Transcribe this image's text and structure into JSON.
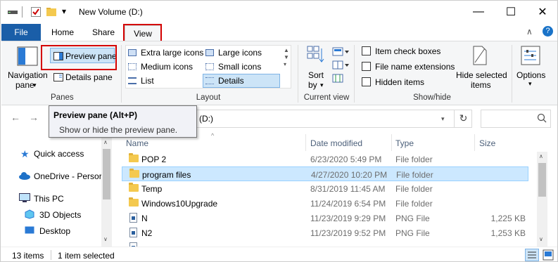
{
  "window": {
    "title": "New Volume (D:)",
    "controls": {
      "minimize": "—",
      "maximize": "☐",
      "close": "✕"
    },
    "qat_dropdown": "▾"
  },
  "tabs": {
    "file": "File",
    "home": "Home",
    "share": "Share",
    "view": "View"
  },
  "ribbon": {
    "panes": {
      "navigation_pane": "Navigation",
      "navigation_pane_2": "pane",
      "preview_pane": "Preview pane",
      "details_pane": "Details pane",
      "group_label": "Panes"
    },
    "layout": {
      "items": [
        "Extra large icons",
        "Large icons",
        "Medium icons",
        "Small icons",
        "List",
        "Details"
      ],
      "group_label": "Layout",
      "selected": "Details"
    },
    "current_view": {
      "sort_by": "Sort",
      "sort_by_2": "by",
      "group_label": "Current view"
    },
    "show_hide": {
      "item_check_boxes": "Item check boxes",
      "file_name_extensions": "File name extensions",
      "hidden_items": "Hidden items",
      "hide_selected_items": "Hide selected",
      "hide_selected_items_2": "items",
      "group_label": "Show/hide"
    },
    "options": {
      "label": "Options"
    }
  },
  "tooltip": {
    "title": "Preview pane (Alt+P)",
    "body": "Show or hide the preview pane."
  },
  "address_bar": {
    "path": "(D:)",
    "refresh": "↻",
    "back": "←",
    "forward": "→"
  },
  "nav_pane": {
    "items": [
      {
        "label": "Quick access",
        "icon": "star-icon"
      },
      {
        "label": "OneDrive - Persor",
        "icon": "cloud-icon"
      },
      {
        "label": "This PC",
        "icon": "computer-icon"
      },
      {
        "label": "3D Objects",
        "icon": "cube-icon"
      },
      {
        "label": "Desktop",
        "icon": "desktop-icon"
      }
    ]
  },
  "file_list": {
    "columns": {
      "name": "Name",
      "date_modified": "Date modified",
      "type": "Type",
      "size": "Size"
    },
    "rows": [
      {
        "name": "POP 2",
        "date": "6/23/2020 5:49 PM",
        "type": "File folder",
        "size": "",
        "icon": "folder-icon",
        "selected": false
      },
      {
        "name": "program files",
        "date": "4/27/2020 10:20 PM",
        "type": "File folder",
        "size": "",
        "icon": "folder-icon",
        "selected": true
      },
      {
        "name": "Temp",
        "date": "8/31/2019 11:45 AM",
        "type": "File folder",
        "size": "",
        "icon": "folder-icon",
        "selected": false
      },
      {
        "name": "Windows10Upgrade",
        "date": "11/24/2019 6:54 PM",
        "type": "File folder",
        "size": "",
        "icon": "folder-icon",
        "selected": false
      },
      {
        "name": "N",
        "date": "11/23/2019 9:29 PM",
        "type": "PNG File",
        "size": "1,225 KB",
        "icon": "png-file-icon",
        "selected": false
      },
      {
        "name": "N2",
        "date": "11/23/2019 9:52 PM",
        "type": "PNG File",
        "size": "1,253 KB",
        "icon": "png-file-icon",
        "selected": false
      }
    ]
  },
  "status_bar": {
    "item_count": "13 items",
    "selected_count": "1 item selected"
  },
  "colors": {
    "file_tab": "#1a5ea8",
    "selection": "#cce8ff",
    "highlight_box": "#d40000"
  }
}
